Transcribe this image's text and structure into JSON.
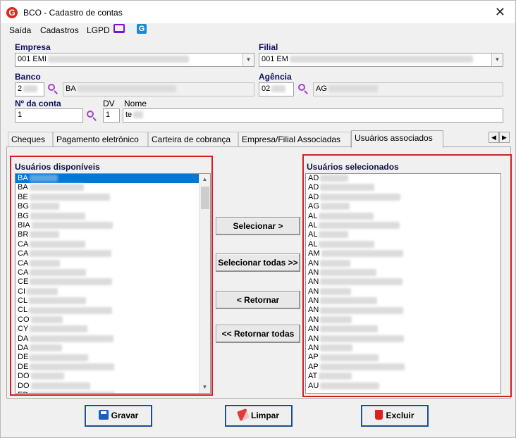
{
  "window": {
    "title": "BCO - Cadastro de contas",
    "close_symbol": "✕",
    "logo_letter": "G"
  },
  "menu": {
    "items": [
      "Saída",
      "Cadastros",
      "LGPD"
    ],
    "icons": [
      "monitor-icon",
      "g-app-icon"
    ]
  },
  "form": {
    "empresa": {
      "label": "Empresa",
      "value": "001 EMI"
    },
    "filial": {
      "label": "Filial",
      "value": "001 EM"
    },
    "banco": {
      "label": "Banco",
      "code": "2",
      "name": "BA"
    },
    "agencia": {
      "label": "Agência",
      "code": "02",
      "name": "AG"
    },
    "conta": {
      "label": "Nº da conta",
      "value": "1"
    },
    "dv": {
      "label": "DV",
      "value": "1"
    },
    "nome": {
      "label": "Nome",
      "value": "te"
    }
  },
  "tabs": [
    {
      "label": "Cheques"
    },
    {
      "label": "Pagamento eletrônico"
    },
    {
      "label": "Carteira de cobrança"
    },
    {
      "label": "Empresa/Filial Associadas"
    },
    {
      "label": "Usuários associados",
      "active": true
    }
  ],
  "tab_scroll": {
    "left": "◀",
    "right": "▶"
  },
  "available": {
    "title": "Usuários disponíveis",
    "items": [
      "BA",
      "BA",
      "BE",
      "BG",
      "BG",
      "BIA",
      "BR",
      "CA",
      "CA",
      "CA",
      "CA",
      "CE",
      "CI",
      "CL",
      "CL",
      "CO",
      "CY",
      "DA",
      "DA",
      "DE",
      "DE",
      "DO",
      "DO",
      "ED"
    ]
  },
  "selected_users": {
    "title": "Usuários selecionados",
    "items": [
      "AD",
      "AD",
      "AD",
      "AG",
      "AL",
      "AL",
      "AL",
      "AL",
      "AM",
      "AN",
      "AN",
      "AN",
      "AN",
      "AN",
      "AN",
      "AN",
      "AN",
      "AN",
      "AN",
      "AP",
      "AP",
      "AT",
      "AU"
    ]
  },
  "transfer_buttons": {
    "select": "Selecionar >",
    "select_all": "Selecionar todas >>",
    "return": "< Retornar",
    "return_all": "<< Retornar todas"
  },
  "footer": {
    "save": "Gravar",
    "clear": "Limpar",
    "delete": "Excluir"
  },
  "colors": {
    "highlight": "#d21f27",
    "selection": "#0078d7",
    "label": "#101060",
    "accent_icon": "#a042d0"
  }
}
